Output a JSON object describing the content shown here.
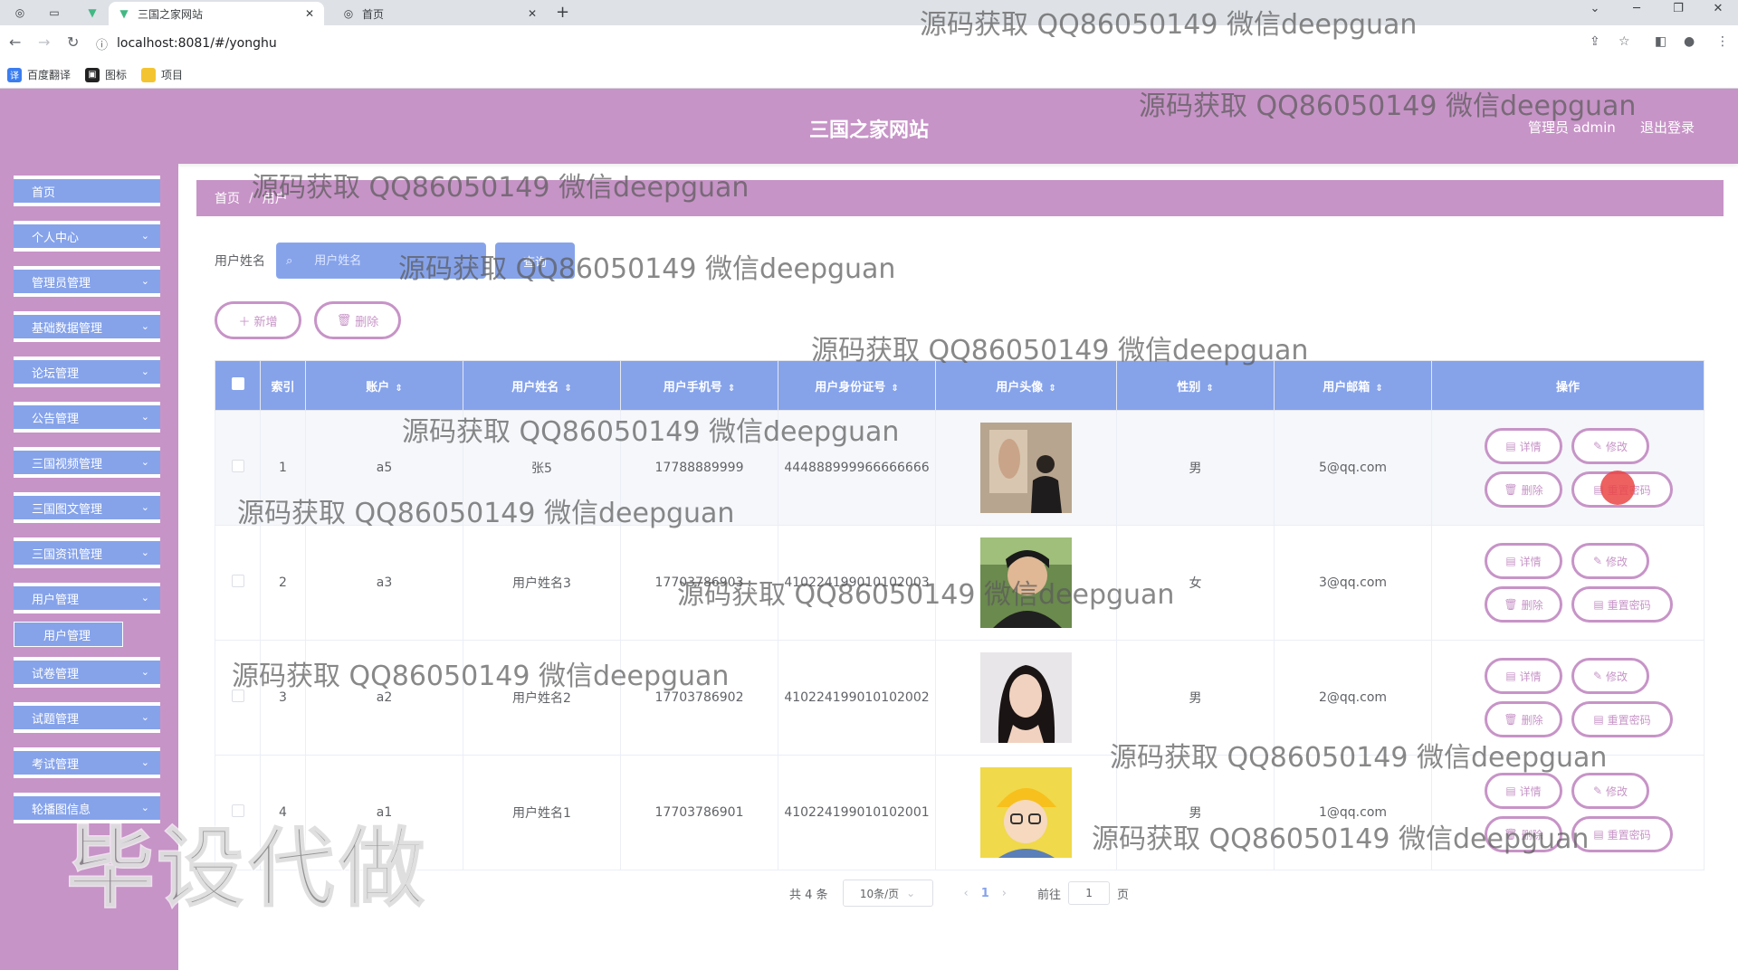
{
  "browser": {
    "tabs": [
      {
        "title": "三国之家网站",
        "active": true
      },
      {
        "title": "首页",
        "active": false
      }
    ],
    "url": "localhost:8081/#/yonghu",
    "bookmarks": [
      "百度翻译",
      "图标",
      "项目"
    ]
  },
  "header": {
    "site_title": "三国之家网站",
    "admin_label": "管理员 admin",
    "logout_label": "退出登录"
  },
  "sidebar": {
    "items": [
      {
        "label": "首页",
        "has_children": false
      },
      {
        "label": "个人中心",
        "has_children": true
      },
      {
        "label": "管理员管理",
        "has_children": true
      },
      {
        "label": "基础数据管理",
        "has_children": true
      },
      {
        "label": "论坛管理",
        "has_children": true
      },
      {
        "label": "公告管理",
        "has_children": true
      },
      {
        "label": "三国视频管理",
        "has_children": true
      },
      {
        "label": "三国图文管理",
        "has_children": true
      },
      {
        "label": "三国资讯管理",
        "has_children": true
      },
      {
        "label": "用户管理",
        "has_children": true
      },
      {
        "label": "试卷管理",
        "has_children": true
      },
      {
        "label": "试题管理",
        "has_children": true
      },
      {
        "label": "考试管理",
        "has_children": true
      },
      {
        "label": "轮播图信息",
        "has_children": true
      }
    ],
    "submenu": {
      "label": "用户管理"
    }
  },
  "breadcrumb": [
    "首页",
    "用户"
  ],
  "search": {
    "label": "用户姓名",
    "placeholder": "用户姓名",
    "button_label": "查询"
  },
  "actions": {
    "add_label": "新增",
    "delete_label": "删除"
  },
  "table": {
    "columns": [
      "索引",
      "账户",
      "用户姓名",
      "用户手机号",
      "用户身份证号",
      "用户头像",
      "性别",
      "用户邮箱",
      "操作"
    ],
    "rows": [
      {
        "index": "1",
        "account": "a5",
        "name": "张5",
        "phone": "17788889999",
        "id_card": "444888999966666666",
        "gender": "男",
        "email": "5@qq.com"
      },
      {
        "index": "2",
        "account": "a3",
        "name": "用户姓名3",
        "phone": "17703786903",
        "id_card": "410224199010102003",
        "gender": "女",
        "email": "3@qq.com"
      },
      {
        "index": "3",
        "account": "a2",
        "name": "用户姓名2",
        "phone": "17703786902",
        "id_card": "410224199010102002",
        "gender": "男",
        "email": "2@qq.com"
      },
      {
        "index": "4",
        "account": "a1",
        "name": "用户姓名1",
        "phone": "17703786901",
        "id_card": "410224199010102001",
        "gender": "男",
        "email": "1@qq.com"
      }
    ],
    "row_ops": {
      "detail": "详情",
      "edit": "修改",
      "delete": "删除",
      "reset": "重置密码"
    }
  },
  "pagination": {
    "total_text": "共 4 条",
    "page_size": "10条/页",
    "current_page": "1",
    "goto_label": "前往",
    "goto_value": "1",
    "page_suffix": "页"
  },
  "watermarks": {
    "line": "源码获取 QQ86050149 微信deepguan",
    "big": "毕设代做"
  },
  "colors": {
    "header_bg": "#c794c7",
    "menu_blue": "#86a3ea",
    "button_border": "#c794c7"
  }
}
